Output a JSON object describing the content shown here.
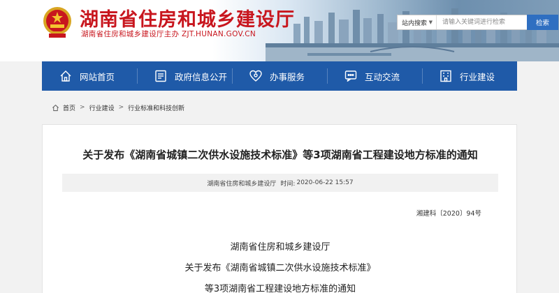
{
  "header": {
    "title": "湖南省住房和城乡建设厅",
    "subtitle": "湖南省住房和城乡建设厅主办 ZJT.HUNAN.GOV.CN"
  },
  "search": {
    "scope": "站内搜索",
    "placeholder": "请输入关键词进行检索",
    "button_label": "检索"
  },
  "nav": {
    "items": [
      {
        "label": "网站首页",
        "icon": "home-icon"
      },
      {
        "label": "政府信息公开",
        "icon": "document-icon"
      },
      {
        "label": "办事服务",
        "icon": "heart-icon"
      },
      {
        "label": "互动交流",
        "icon": "chat-icon"
      },
      {
        "label": "行业建设",
        "icon": "building-icon"
      }
    ]
  },
  "breadcrumb": {
    "items": [
      "首页",
      "行业建设",
      "行业标准和科技创新"
    ]
  },
  "article": {
    "title": "关于发布《湖南省城镇二次供水设施技术标准》等3项湖南省工程建设地方标准的通知",
    "source": "湖南省住房和城乡建设厅",
    "time_label": "时间:",
    "time": "2020-06-22 15:57",
    "doc_number": "湘建科〔2020〕94号",
    "body_lines": [
      "湖南省住房和城乡建设厅",
      "关于发布《湖南省城镇二次供水设施技术标准》",
      "等3项湖南省工程建设地方标准的通知"
    ]
  },
  "colors": {
    "brand_red": "#c8161e",
    "nav_blue": "#1f5aa8",
    "search_blue": "#2f6fc1"
  }
}
